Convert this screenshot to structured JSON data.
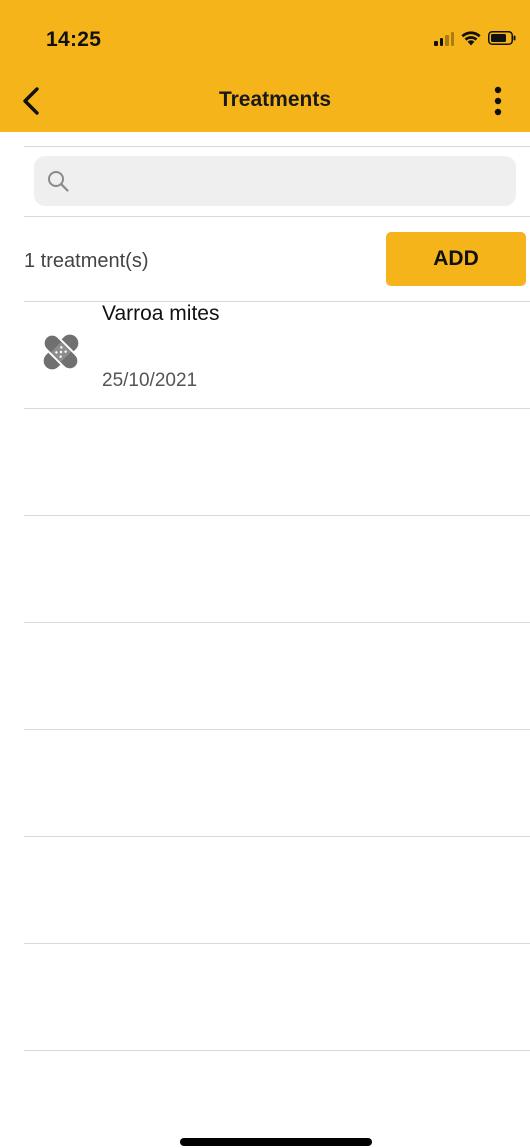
{
  "status_bar": {
    "time": "14:25"
  },
  "nav": {
    "title": "Treatments",
    "back_icon": "chevron-left-icon",
    "more_icon": "more-vertical-icon"
  },
  "search": {
    "placeholder": "",
    "value": "",
    "icon": "search-icon"
  },
  "summary": {
    "count_label": "1 treatment(s)",
    "add_label": "ADD"
  },
  "treatments": [
    {
      "name": "Varroa mites",
      "date": "25/10/2021",
      "icon": "bandage-icon"
    }
  ],
  "colors": {
    "accent": "#f4b41a",
    "divider": "#d9d9d9",
    "search_bg": "#efefef",
    "icon_gray": "#6f6f6f"
  }
}
